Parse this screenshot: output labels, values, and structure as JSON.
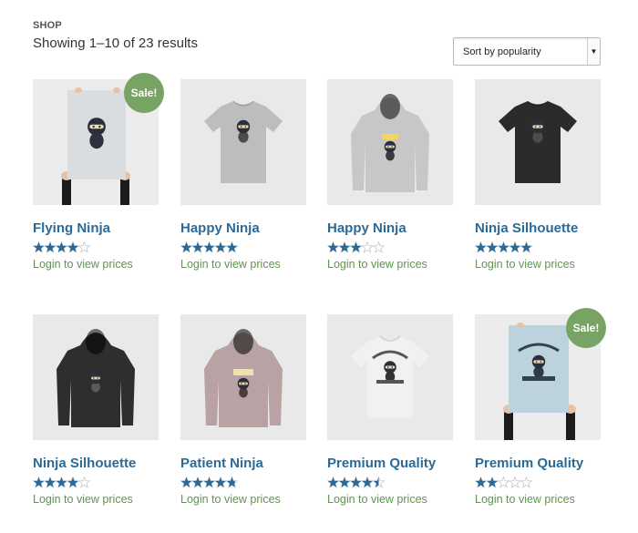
{
  "breadcrumb": "SHOP",
  "result_count": "Showing 1–10 of 23 results",
  "sort": {
    "selected": "Sort by popularity"
  },
  "colors": {
    "link": "#2b6a97",
    "price": "#5f9451",
    "sale_badge": "#77a464",
    "star": "#2b6a97"
  },
  "products": [
    {
      "name": "Flying Ninja",
      "rating": 4,
      "price_text": "Login to view prices",
      "sale": "Sale!",
      "image": "poster-ninja-icon"
    },
    {
      "name": "Happy Ninja",
      "rating": 5,
      "price_text": "Login to view prices",
      "sale": null,
      "image": "tshirt-gray-icon"
    },
    {
      "name": "Happy Ninja",
      "rating": 3,
      "price_text": "Login to view prices",
      "sale": null,
      "image": "hoodie-gray-icon"
    },
    {
      "name": "Ninja Silhouette",
      "rating": 5,
      "price_text": "Login to view prices",
      "sale": null,
      "image": "tshirt-black-icon"
    },
    {
      "name": "Ninja Silhouette",
      "rating": 4,
      "price_text": "Login to view prices",
      "sale": null,
      "image": "hoodie-black-icon"
    },
    {
      "name": "Patient Ninja",
      "rating": 4.75,
      "price_text": "Login to view prices",
      "sale": null,
      "image": "hoodie-pink-icon"
    },
    {
      "name": "Premium Quality",
      "rating": 4.5,
      "price_text": "Login to view prices",
      "sale": null,
      "image": "tshirt-white-icon"
    },
    {
      "name": "Premium Quality",
      "rating": 2,
      "price_text": "Login to view prices",
      "sale": "Sale!",
      "image": "poster-woo-icon"
    }
  ]
}
